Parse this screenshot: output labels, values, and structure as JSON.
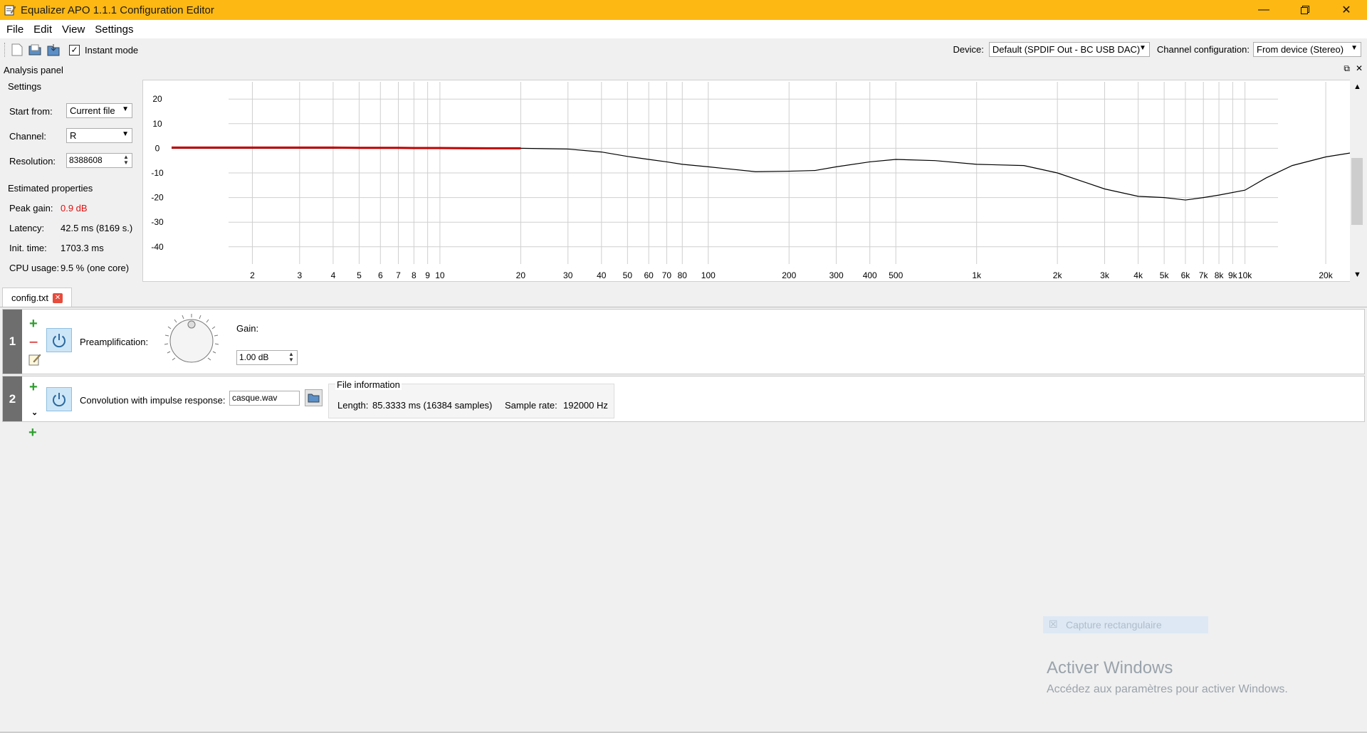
{
  "window": {
    "title": "Equalizer APO 1.1.1 Configuration Editor"
  },
  "menu": [
    "File",
    "Edit",
    "View",
    "Settings"
  ],
  "toolbar": {
    "instant_mode_label": "Instant mode",
    "instant_mode_checked": true,
    "device_label": "Device:",
    "device_value": "Default (SPDIF Out - BC USB DAC)",
    "channel_config_label": "Channel configuration:",
    "channel_config_value": "From device (Stereo)"
  },
  "analysis": {
    "panel_title": "Analysis panel",
    "settings_title": "Settings",
    "start_from_label": "Start from:",
    "start_from_value": "Current file",
    "channel_label": "Channel:",
    "channel_value": "R",
    "resolution_label": "Resolution:",
    "resolution_value": "8388608",
    "estimated_title": "Estimated properties",
    "peak_gain_label": "Peak gain:",
    "peak_gain_value": "0.9 dB",
    "latency_label": "Latency:",
    "latency_value": "42.5 ms (8169 s.)",
    "init_time_label": "Init. time:",
    "init_time_value": "1703.3 ms",
    "cpu_label": "CPU usage:",
    "cpu_value": "9.5 % (one core)"
  },
  "chart_data": {
    "type": "line",
    "xscale": "log",
    "xlim": [
      1,
      26000
    ],
    "ylim": [
      -47,
      27
    ],
    "yticks": [
      20,
      10,
      0,
      -10,
      -20,
      -30,
      -40
    ],
    "ytick_labels": [
      "20",
      "10",
      "0",
      "-10",
      "-20",
      "-30",
      "-40"
    ],
    "xticks": [
      2,
      3,
      4,
      5,
      6,
      7,
      8,
      9,
      10,
      20,
      30,
      40,
      50,
      60,
      70,
      80,
      100,
      200,
      300,
      400,
      500,
      1000,
      2000,
      3000,
      4000,
      5000,
      6000,
      7000,
      8000,
      9000,
      10000,
      20000
    ],
    "xtick_labels": [
      "2",
      "3",
      "4",
      "5",
      "6",
      "7",
      "8",
      "9",
      "10",
      "20",
      "30",
      "40",
      "50",
      "60",
      "70",
      "80",
      "100",
      "200",
      "300",
      "400",
      "500",
      "1k",
      "2k",
      "3k",
      "4k",
      "5k",
      "6k",
      "7k",
      "8k",
      "9k",
      "10k",
      "20k"
    ],
    "grid": true,
    "series": [
      {
        "color": "#000000",
        "x": [
          1,
          10,
          20,
          30,
          40,
          50,
          60,
          70,
          80,
          100,
          150,
          200,
          250,
          300,
          400,
          500,
          700,
          1000,
          1500,
          2000,
          3000,
          4000,
          5000,
          6000,
          7000,
          8000,
          10000,
          12000,
          15000,
          20000,
          26000
        ],
        "y": [
          0,
          0,
          0,
          -0.3,
          -1.5,
          -3.3,
          -4.5,
          -5.5,
          -6.5,
          -7.5,
          -9.5,
          -9.3,
          -9.0,
          -7.5,
          -5.5,
          -4.5,
          -5,
          -6.5,
          -7,
          -10,
          -16.5,
          -19.5,
          -20,
          -21,
          -20,
          -19,
          -17,
          -12,
          -7,
          -3.5,
          -1.5
        ]
      },
      {
        "color": "#c00000",
        "x": [
          1,
          2,
          3,
          4,
          5,
          6,
          7,
          8,
          9,
          10,
          15,
          20
        ],
        "y": [
          0.3,
          0.3,
          0.3,
          0.3,
          0.2,
          0.2,
          0.2,
          0.1,
          0.1,
          0.1,
          0,
          0
        ]
      }
    ]
  },
  "tab": {
    "label": "config.txt"
  },
  "row1": {
    "number": "1",
    "preamp_label": "Preamplification:",
    "gain_label": "Gain:",
    "gain_value": "1.00 dB"
  },
  "row2": {
    "number": "2",
    "convolution_label": "Convolution with impulse response:",
    "file_value": "casque.wav",
    "file_info_title": "File information",
    "length_label": "Length:",
    "length_value": "85.3333 ms (16384 samples)",
    "sample_rate_label": "Sample rate:",
    "sample_rate_value": "192000 Hz"
  },
  "overlay": {
    "capture_label": "Capture rectangulaire",
    "activate_title": "Activer Windows",
    "activate_sub": "Accédez aux paramètres pour activer Windows."
  }
}
